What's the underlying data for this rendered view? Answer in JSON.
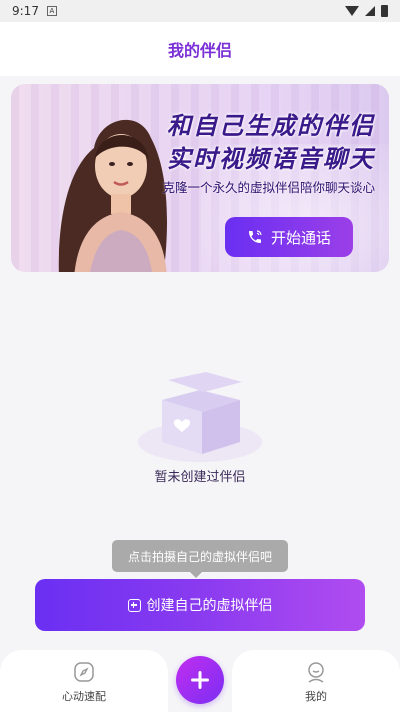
{
  "status_bar": {
    "time": "9:17",
    "app_glyph": "A"
  },
  "header": {
    "title": "我的伴侣"
  },
  "banner": {
    "headline_1": "和自己生成的伴侣",
    "headline_2": "实时视频语音聊天",
    "subtitle": "克隆一个永久的虚拟伴侣陪你聊天谈心",
    "call_button_label": "开始通话",
    "call_icon": "phone-icon"
  },
  "empty_state": {
    "text": "暂未创建过伴侣",
    "icon": "empty-box-icon"
  },
  "tooltip": {
    "text": "点击拍摄自己的虚拟伴侣吧"
  },
  "create_button": {
    "label": "创建自己的虚拟伴侣",
    "icon": "plus-square-icon"
  },
  "tabbar": {
    "left_label": "心动速配",
    "left_icon": "compass-icon",
    "center_icon": "plus-icon",
    "right_label": "我的",
    "right_icon": "profile-icon"
  },
  "colors": {
    "accent": "#7b2fd6",
    "gradient_start": "#6a2ff2",
    "gradient_end": "#b04cf0"
  }
}
